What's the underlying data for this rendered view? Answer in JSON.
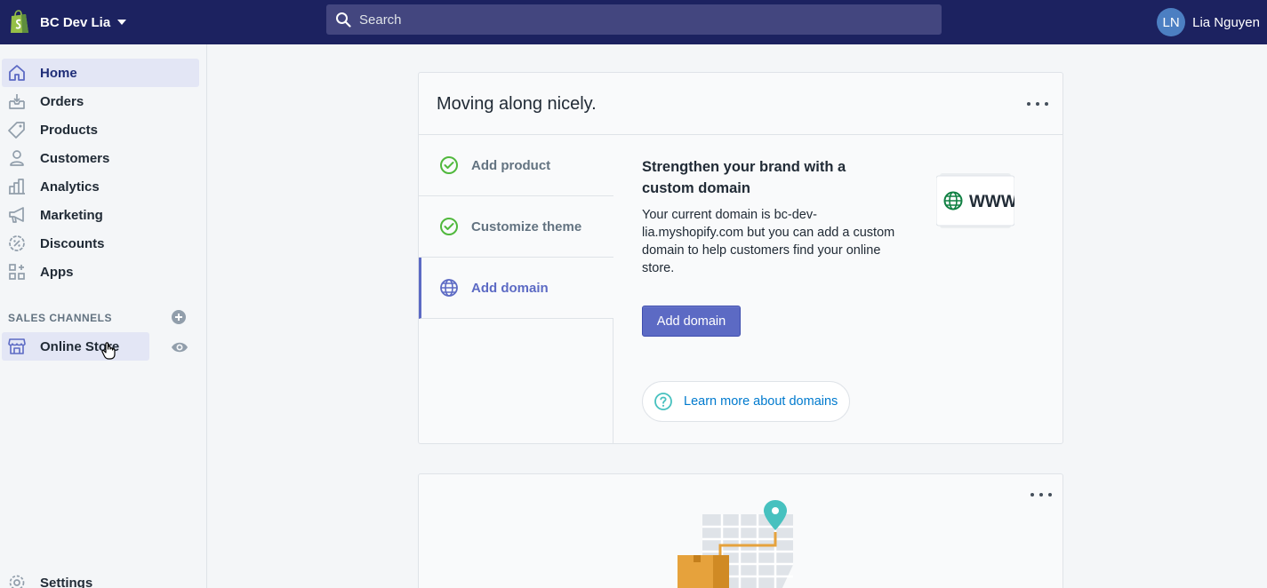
{
  "topbar": {
    "store_name": "BC Dev Lia",
    "search_placeholder": "Search",
    "user_initials": "LN",
    "user_name": "Lia Nguyen"
  },
  "sidebar": {
    "items": [
      {
        "label": "Home",
        "icon": "home-icon"
      },
      {
        "label": "Orders",
        "icon": "orders-icon"
      },
      {
        "label": "Products",
        "icon": "tag-icon"
      },
      {
        "label": "Customers",
        "icon": "person-icon"
      },
      {
        "label": "Analytics",
        "icon": "bar-chart-icon"
      },
      {
        "label": "Marketing",
        "icon": "megaphone-icon"
      },
      {
        "label": "Discounts",
        "icon": "discount-icon"
      },
      {
        "label": "Apps",
        "icon": "apps-icon"
      }
    ],
    "sales_channels_title": "SALES CHANNELS",
    "online_store_label": "Online Store",
    "settings_label": "Settings"
  },
  "setup_card": {
    "title": "Moving along nicely.",
    "steps": [
      {
        "label": "Add product",
        "status": "complete"
      },
      {
        "label": "Customize theme",
        "status": "complete"
      },
      {
        "label": "Add domain",
        "status": "active"
      }
    ],
    "detail_title": "Strengthen your brand with a custom domain",
    "detail_text": "Your current domain is bc-dev-lia.myshopify.com but you can add a custom domain to help customers find your online store.",
    "primary_button": "Add domain",
    "learn_more": "Learn more about domains",
    "illustration_text": "WWW"
  },
  "colors": {
    "topbar": "#1c2260",
    "accent": "#5c6ac4",
    "success": "#50b83c",
    "link": "#007ace"
  }
}
